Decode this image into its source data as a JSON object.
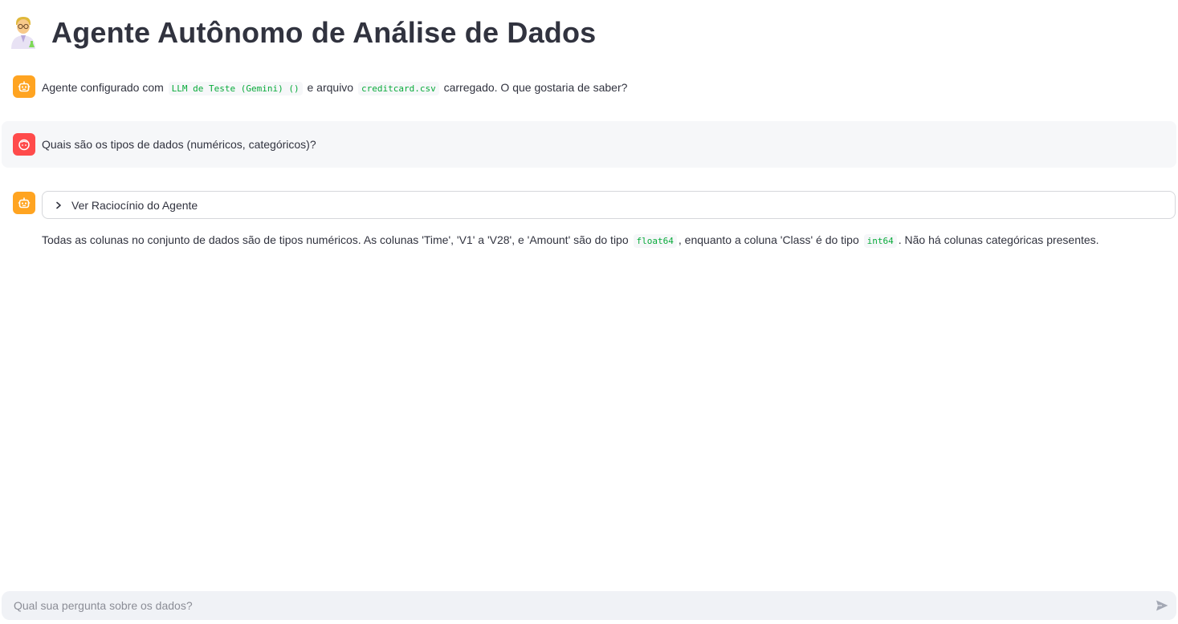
{
  "header": {
    "title": "Agente Autônomo de Análise de Dados",
    "emoji_icon": "scientist-emoji-icon"
  },
  "messages": [
    {
      "role": "assistant",
      "avatar_icon": "robot-icon",
      "parts": {
        "t1": "Agente configurado com",
        "code1": "LLM de Teste (Gemini) ()",
        "t2": "e arquivo",
        "code2": "creditcard.csv",
        "t3": "carregado. O que gostaria de saber?"
      }
    },
    {
      "role": "user",
      "avatar_icon": "face-icon",
      "text": "Quais são os tipos de dados (numéricos, categóricos)?"
    },
    {
      "role": "assistant",
      "avatar_icon": "robot-icon",
      "expander_label": "Ver Raciocínio do Agente",
      "parts": {
        "t1": "Todas as colunas no conjunto de dados são de tipos numéricos. As colunas 'Time', 'V1' a 'V28', e 'Amount' são do tipo",
        "code1": "float64",
        "t2": ", enquanto a coluna 'Class' é do tipo",
        "code2": "int64",
        "t3": ". Não há colunas categóricas presentes."
      }
    }
  ],
  "chat_input": {
    "placeholder": "Qual sua pergunta sobre os dados?",
    "send_icon": "send-icon"
  },
  "colors": {
    "assistant_avatar": "#ffa421",
    "user_avatar": "#ff4b4b",
    "code_text": "#09ab3b",
    "user_message_bg": "#f6f7f9",
    "input_bg": "#f0f2f6"
  }
}
